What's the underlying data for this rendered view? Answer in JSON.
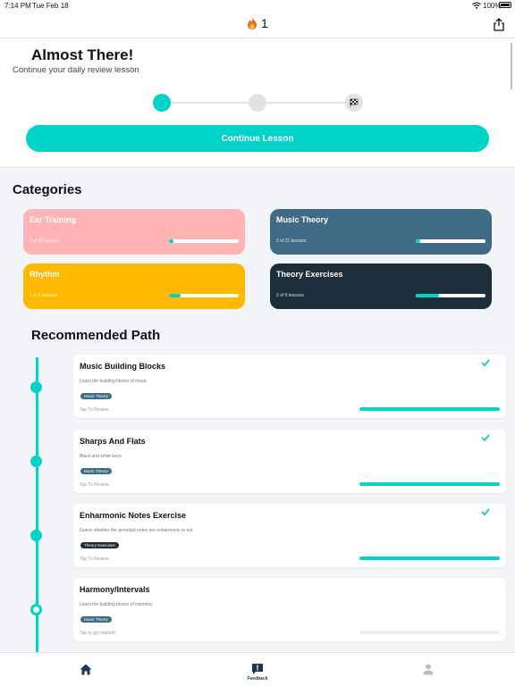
{
  "status_bar": {
    "time": "7:14 PM",
    "date": "Tue Feb 18",
    "battery": "100%"
  },
  "header": {
    "streak_count": "1",
    "streak_icon": "fire-icon",
    "share_icon": "share-icon"
  },
  "lesson": {
    "title": "Almost There!",
    "subtitle": "Continue your daily review lesson",
    "button_label": "Continue Lesson",
    "steps_completed": 1,
    "steps_total": 3
  },
  "categories": {
    "heading": "Categories",
    "items": [
      {
        "name": "Ear Training",
        "count": "3 of 42 lessons",
        "progress": 0.03,
        "color": "#ffb3b3"
      },
      {
        "name": "Music Theory",
        "count": "2 of 21 lessons",
        "progress": 0.06,
        "color": "#3f6b85"
      },
      {
        "name": "Rhythm",
        "count": "1 of 6 lessons",
        "progress": 0.17,
        "color": "#ffb800"
      },
      {
        "name": "Theory Exercises",
        "count": "2 of 6 lessons",
        "progress": 0.33,
        "color": "#1d2e3b"
      }
    ]
  },
  "path": {
    "heading": "Recommended Path",
    "items": [
      {
        "title": "Music Building Blocks",
        "desc": "Learn the building blocks of music",
        "tag": "Music Theory",
        "tag_color": "#3f6b85",
        "hint": "Tap To Review",
        "progress": 1,
        "done": true
      },
      {
        "title": "Sharps And Flats",
        "desc": "Black and white keys",
        "tag": "Music Theory",
        "tag_color": "#3f6b85",
        "hint": "Tap To Review",
        "progress": 1,
        "done": true
      },
      {
        "title": "Enharmonic Notes Exercise",
        "desc": "Guess whether the provided notes are enharmonic or not",
        "tag": "Theory Exercises",
        "tag_color": "#1d2e3b",
        "hint": "Tap To Review",
        "progress": 1,
        "done": true
      },
      {
        "title": "Harmony/Intervals",
        "desc": "Learn the building blocks of harmony",
        "tag": "Music Theory",
        "tag_color": "#3f6b85",
        "hint": "Tap to get started!",
        "progress": 0,
        "done": false
      }
    ]
  },
  "tabs": [
    {
      "label": "",
      "icon": "home-icon"
    },
    {
      "label": "Feedback",
      "icon": "feedback-icon"
    },
    {
      "label": "",
      "icon": "profile-icon"
    }
  ],
  "colors": {
    "accent": "#00d4c8",
    "track": "#e2e2e2"
  }
}
